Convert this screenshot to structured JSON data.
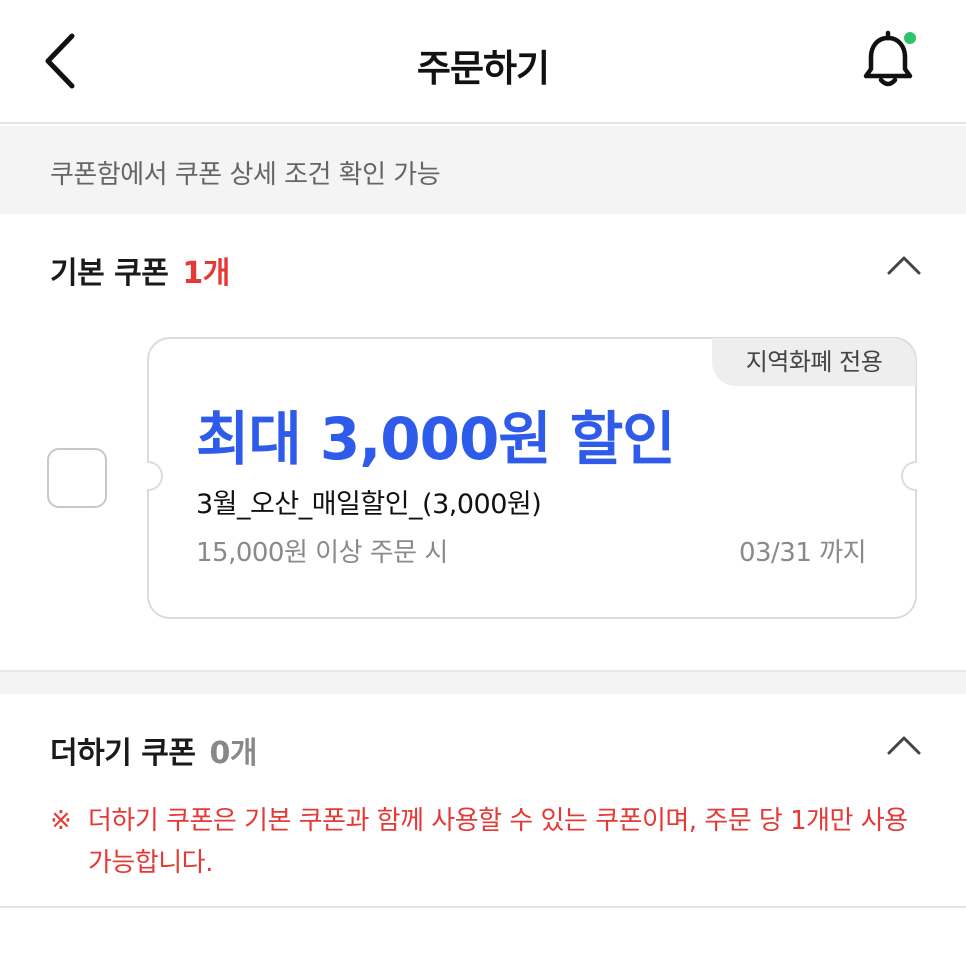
{
  "header": {
    "title": "주문하기",
    "back_icon": "chevron-left-icon",
    "bell_icon": "bell-icon",
    "bell_badge_color": "#2bc46b"
  },
  "notice": {
    "text": "쿠폰함에서 쿠폰 상세 조건 확인 가능"
  },
  "basic_coupons": {
    "title": "기본 쿠폰",
    "count": "1개",
    "items": [
      {
        "badge": "지역화폐 전용",
        "amount": "최대 3,000원 할인",
        "name": "3월_오산_매일할인_(3,000원)",
        "condition": "15,000원 이상 주문 시",
        "expiry": "03/31 까지",
        "checked": false
      }
    ]
  },
  "add_coupons": {
    "title": "더하기 쿠폰",
    "count": "0개",
    "note_mark": "※",
    "note": "더하기 쿠폰은 기본 쿠폰과 함께 사용할 수 있는 쿠폰이며, 주문 당 1개만 사용 가능합니다."
  },
  "colors": {
    "accent_blue": "#2f5bea",
    "alert_red": "#e53935",
    "muted_gray": "#8a8a8a"
  }
}
